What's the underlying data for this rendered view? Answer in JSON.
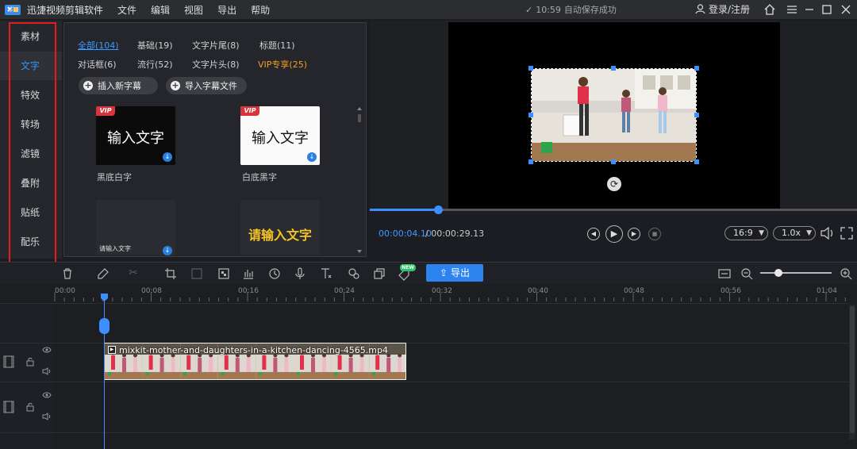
{
  "app": {
    "title": "迅捷视频剪辑软件"
  },
  "menu": [
    "文件",
    "编辑",
    "视图",
    "导出",
    "帮助"
  ],
  "status": {
    "time": "10:59",
    "autosave": "自动保存成功"
  },
  "account": {
    "login": "登录/注册"
  },
  "leftnav": {
    "items": [
      "素材",
      "文字",
      "特效",
      "转场",
      "滤镜",
      "叠附",
      "贴纸",
      "配乐"
    ],
    "active_index": 1
  },
  "library": {
    "filters_row1": [
      "全部(104)",
      "基础(19)",
      "文字片尾(8)",
      "标题(11)"
    ],
    "filters_row2": [
      "对话框(6)",
      "流行(52)",
      "文字片头(8)",
      "VIP专享(25)"
    ],
    "insert_subtitle": "插入新字幕",
    "import_subtitle": "导入字幕文件",
    "templates": [
      {
        "text": "输入文字",
        "label": "黑底白字",
        "vip": true
      },
      {
        "text": "输入文字",
        "label": "白底黑字",
        "vip": true
      },
      {
        "text": "请输入文字",
        "label": "",
        "vip": false
      },
      {
        "text": "请输入文字",
        "label": "",
        "vip": false
      }
    ],
    "vip_badge": "VIP"
  },
  "player": {
    "current_time": "00:00:04.10",
    "total_time": "/ 00:00:29.13",
    "progress": 0.14,
    "aspect": "16:9",
    "speed": "1.0x"
  },
  "toolbar": {
    "export_label": "导出",
    "new_badge": "NEW",
    "zoom": 0.25
  },
  "timeline": {
    "ticks": [
      "00:00",
      "00:08",
      "00:16",
      "00:24",
      "00:32",
      "00:40",
      "00:48",
      "00:56",
      "01:04"
    ],
    "clip_name": "mixkit-mother-and-daughters-in-a-kitchen-dancing-4565.mp4"
  },
  "colors": {
    "accent": "#3b8fff",
    "vip": "#f0a020",
    "highlight": "#e11d1d",
    "export": "#2c84f0"
  },
  "icons": [
    "logo-icon",
    "check-icon",
    "user-icon",
    "home-icon",
    "menu-icon",
    "minimize-icon",
    "maximize-icon",
    "close-icon",
    "plus-icon",
    "download-icon",
    "rotate-icon",
    "play-icon",
    "volume-icon",
    "fullscreen-icon",
    "undo-icon",
    "redo-icon",
    "delete-icon",
    "edit-icon",
    "cut-icon",
    "crop-icon",
    "mosaic-icon",
    "audio-icon",
    "speed-icon",
    "mic-icon",
    "text-icon",
    "eye-icon",
    "lock-icon",
    "film-icon"
  ]
}
